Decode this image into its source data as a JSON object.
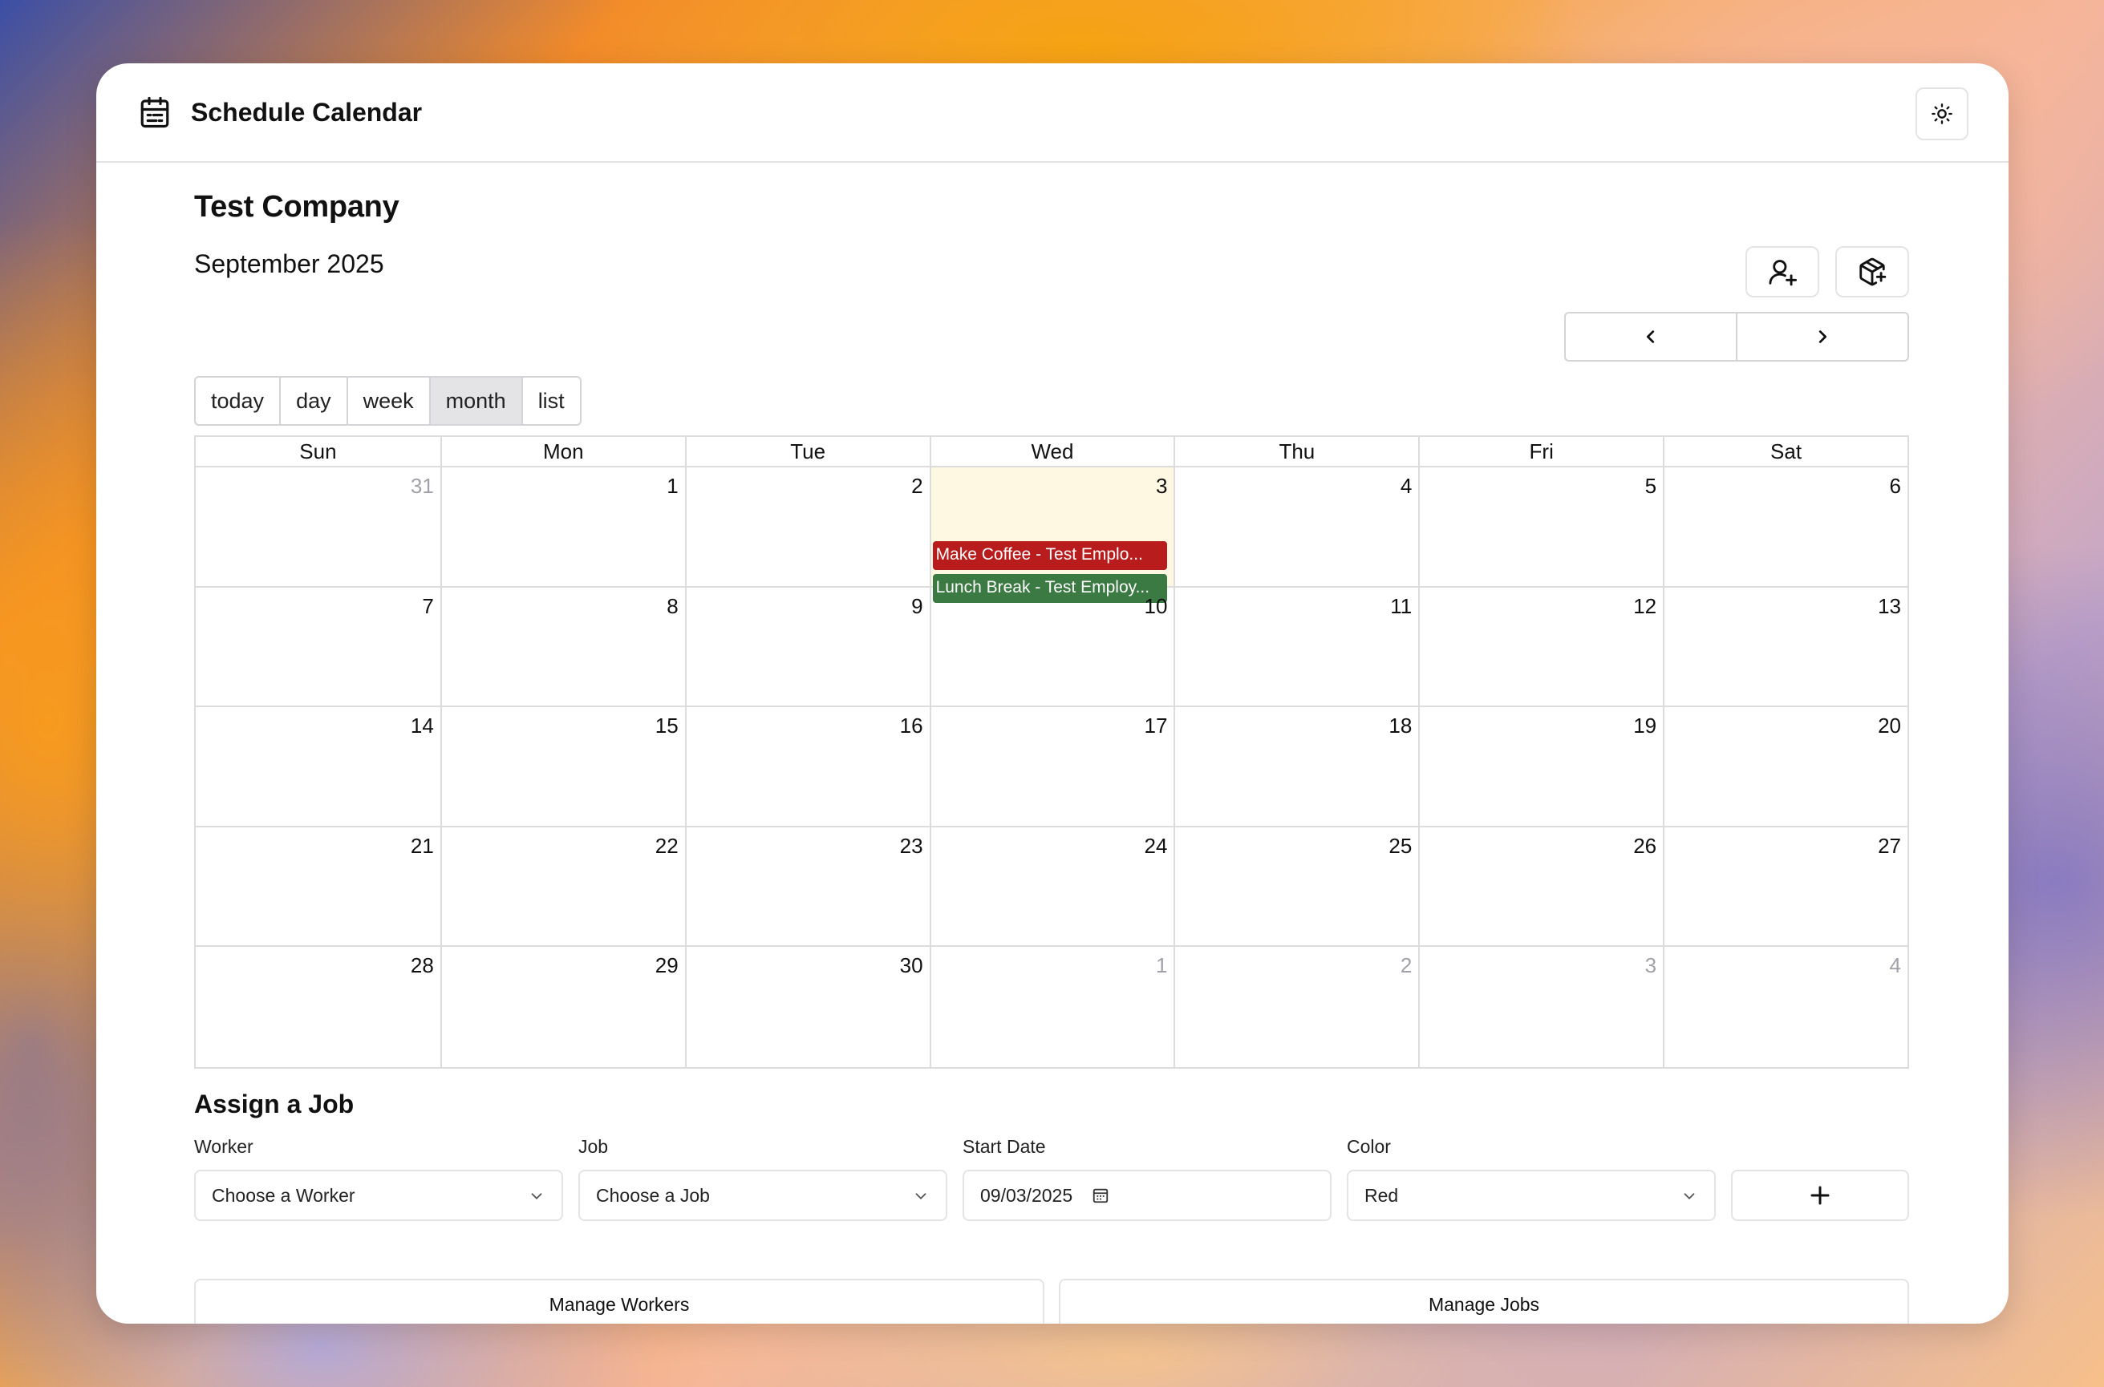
{
  "app": {
    "title": "Schedule Calendar",
    "icon": "calendar-icon",
    "theme_icon": "sun-icon"
  },
  "header": {
    "company": "Test Company",
    "month_label": "September 2025",
    "add_worker_icon": "user-plus-icon",
    "add_job_icon": "package-plus-icon",
    "prev_icon": "chevron-left-icon",
    "next_icon": "chevron-right-icon"
  },
  "views": [
    {
      "label": "today",
      "active": false
    },
    {
      "label": "day",
      "active": false
    },
    {
      "label": "week",
      "active": false
    },
    {
      "label": "month",
      "active": true
    },
    {
      "label": "list",
      "active": false
    }
  ],
  "calendar": {
    "weekdays": [
      "Sun",
      "Mon",
      "Tue",
      "Wed",
      "Thu",
      "Fri",
      "Sat"
    ],
    "weeks": [
      [
        {
          "d": "31",
          "other": true
        },
        {
          "d": "1"
        },
        {
          "d": "2"
        },
        {
          "d": "3",
          "today": true
        },
        {
          "d": "4"
        },
        {
          "d": "5"
        },
        {
          "d": "6"
        }
      ],
      [
        {
          "d": "7"
        },
        {
          "d": "8"
        },
        {
          "d": "9"
        },
        {
          "d": "10"
        },
        {
          "d": "11"
        },
        {
          "d": "12"
        },
        {
          "d": "13"
        }
      ],
      [
        {
          "d": "14"
        },
        {
          "d": "15"
        },
        {
          "d": "16"
        },
        {
          "d": "17"
        },
        {
          "d": "18"
        },
        {
          "d": "19"
        },
        {
          "d": "20"
        }
      ],
      [
        {
          "d": "21"
        },
        {
          "d": "22"
        },
        {
          "d": "23"
        },
        {
          "d": "24"
        },
        {
          "d": "25"
        },
        {
          "d": "26"
        },
        {
          "d": "27"
        }
      ],
      [
        {
          "d": "28"
        },
        {
          "d": "29"
        },
        {
          "d": "30"
        },
        {
          "d": "1",
          "other": true
        },
        {
          "d": "2",
          "other": true
        },
        {
          "d": "3",
          "other": true
        },
        {
          "d": "4",
          "other": true
        }
      ]
    ],
    "events": [
      {
        "week": 0,
        "day": 3,
        "label": "Make Coffee - Test Emplo...",
        "color": "#b91c1c"
      },
      {
        "week": 0,
        "day": 3,
        "label": "Lunch Break - Test Employ...",
        "color": "#3c7a44"
      }
    ],
    "today_bg": "#fef8e3"
  },
  "assign": {
    "title": "Assign a Job",
    "worker_label": "Worker",
    "worker_value": "Choose a Worker",
    "job_label": "Job",
    "job_value": "Choose a Job",
    "start_label": "Start Date",
    "start_value": "09/03/2025",
    "color_label": "Color",
    "color_value": "Red",
    "add_icon": "plus-icon"
  },
  "manage": {
    "workers": "Manage Workers",
    "jobs": "Manage Jobs"
  }
}
